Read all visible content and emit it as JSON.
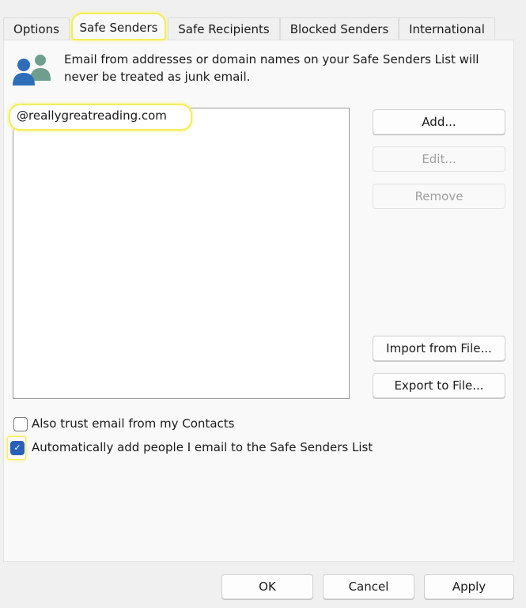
{
  "tabs": [
    {
      "label": "Options",
      "active": false
    },
    {
      "label": "Safe Senders",
      "active": true
    },
    {
      "label": "Safe Recipients",
      "active": false
    },
    {
      "label": "Blocked Senders",
      "active": false
    },
    {
      "label": "International",
      "active": false
    }
  ],
  "description": {
    "icon": "people-icon",
    "line1": "Email from addresses or domain names on your Safe Senders List will",
    "line2": "never be treated as junk email."
  },
  "list": {
    "items": [
      "@reallygreatreading.com"
    ]
  },
  "buttons": {
    "add": "Add...",
    "edit": "Edit...",
    "remove": "Remove",
    "import": "Import from File...",
    "export": "Export to File..."
  },
  "options": {
    "trust_contacts": {
      "label": "Also trust email from my Contacts",
      "checked": false
    },
    "auto_add": {
      "label": "Automatically add people I email to the Safe Senders List",
      "checked": true
    }
  },
  "footer": {
    "ok": "OK",
    "cancel": "Cancel",
    "apply": "Apply"
  },
  "colors": {
    "highlight": "#f2ee5a",
    "checkbox_checked": "#2a5fb8"
  }
}
